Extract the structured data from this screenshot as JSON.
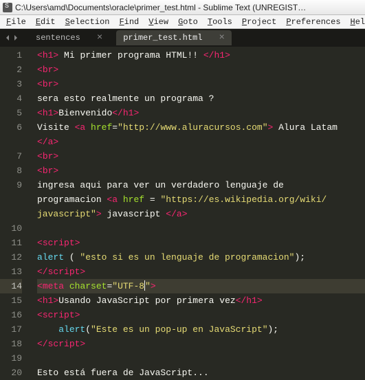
{
  "title": "C:\\Users\\amd\\Documents\\oracle\\primer_test.html - Sublime Text (UNREGIST…",
  "menu": [
    "File",
    "Edit",
    "Selection",
    "Find",
    "View",
    "Goto",
    "Tools",
    "Project",
    "Preferences",
    "Help"
  ],
  "tabs": [
    {
      "label": "sentences",
      "active": false
    },
    {
      "label": "primer_test.html",
      "active": true
    }
  ],
  "highlighted_line": 14,
  "lines": [
    {
      "n": 1,
      "seg": [
        [
          "t-tag",
          "<"
        ],
        [
          "t-tag",
          "h1"
        ],
        [
          "t-tag",
          ">"
        ],
        [
          "t-txt",
          " Mi primer programa HTML!! "
        ],
        [
          "t-tag",
          "</"
        ],
        [
          "t-tag",
          "h1"
        ],
        [
          "t-tag",
          ">"
        ]
      ]
    },
    {
      "n": 2,
      "seg": [
        [
          "t-tag",
          "<"
        ],
        [
          "t-tag",
          "br"
        ],
        [
          "t-tag",
          ">"
        ]
      ]
    },
    {
      "n": 3,
      "seg": [
        [
          "t-tag",
          "<"
        ],
        [
          "t-tag",
          "br"
        ],
        [
          "t-tag",
          ">"
        ]
      ]
    },
    {
      "n": 4,
      "seg": [
        [
          "t-txt",
          "sera esto realmente un programa ?"
        ]
      ]
    },
    {
      "n": 5,
      "seg": [
        [
          "t-tag",
          "<"
        ],
        [
          "t-tag",
          "h1"
        ],
        [
          "t-tag",
          ">"
        ],
        [
          "t-txt",
          "Bienvenido"
        ],
        [
          "t-tag",
          "</"
        ],
        [
          "t-tag",
          "h1"
        ],
        [
          "t-tag",
          ">"
        ]
      ]
    },
    {
      "n": 6,
      "seg": [
        [
          "t-txt",
          "Visite "
        ],
        [
          "t-tag",
          "<"
        ],
        [
          "t-tag",
          "a"
        ],
        [
          "t-txt",
          " "
        ],
        [
          "t-attr",
          "href"
        ],
        [
          "t-txt",
          "="
        ],
        [
          "t-str",
          "\"http://www.aluracursos.com\""
        ],
        [
          "t-tag",
          ">"
        ],
        [
          "t-txt",
          " Alura Latam"
        ]
      ]
    },
    {
      "n": "",
      "seg": [
        [
          "t-tag",
          "</"
        ],
        [
          "t-tag",
          "a"
        ],
        [
          "t-tag",
          ">"
        ]
      ]
    },
    {
      "n": 7,
      "seg": [
        [
          "t-tag",
          "<"
        ],
        [
          "t-tag",
          "br"
        ],
        [
          "t-tag",
          ">"
        ]
      ]
    },
    {
      "n": 8,
      "seg": [
        [
          "t-tag",
          "<"
        ],
        [
          "t-tag",
          "br"
        ],
        [
          "t-tag",
          ">"
        ]
      ]
    },
    {
      "n": 9,
      "seg": [
        [
          "t-txt",
          "ingresa aqui para ver un verdadero lenguaje de "
        ]
      ]
    },
    {
      "n": "",
      "seg": [
        [
          "t-txt",
          "programacion "
        ],
        [
          "t-tag",
          "<"
        ],
        [
          "t-tag",
          "a"
        ],
        [
          "t-txt",
          " "
        ],
        [
          "t-attr",
          "href"
        ],
        [
          "t-txt",
          " = "
        ],
        [
          "t-str",
          "\"https://es.wikipedia.org/wiki/"
        ]
      ]
    },
    {
      "n": "",
      "seg": [
        [
          "t-str",
          "javascript\""
        ],
        [
          "t-tag",
          ">"
        ],
        [
          "t-txt",
          " javascript "
        ],
        [
          "t-tag",
          "</"
        ],
        [
          "t-tag",
          "a"
        ],
        [
          "t-tag",
          ">"
        ]
      ]
    },
    {
      "n": 10,
      "seg": []
    },
    {
      "n": 11,
      "seg": [
        [
          "t-tag",
          "<"
        ],
        [
          "t-tag",
          "script"
        ],
        [
          "t-tag",
          ">"
        ]
      ]
    },
    {
      "n": 12,
      "seg": [
        [
          "t-fn",
          "alert"
        ],
        [
          "t-txt",
          " ( "
        ],
        [
          "t-str",
          "\"esto si es un lenguaje de programacion\""
        ],
        [
          "t-txt",
          ");"
        ]
      ]
    },
    {
      "n": 13,
      "seg": [
        [
          "t-tag",
          "</"
        ],
        [
          "t-tag",
          "script"
        ],
        [
          "t-tag",
          ">"
        ]
      ]
    },
    {
      "n": 14,
      "seg": [
        [
          "t-tag",
          "<"
        ],
        [
          "t-tag",
          "meta"
        ],
        [
          "t-txt",
          " "
        ],
        [
          "t-attr",
          "charset"
        ],
        [
          "t-txt",
          "="
        ],
        [
          "t-str",
          "\"UTF-8"
        ],
        [
          "cursor",
          ""
        ],
        [
          "t-str",
          "\""
        ],
        [
          "t-tag",
          ">"
        ]
      ]
    },
    {
      "n": 15,
      "seg": [
        [
          "t-tag",
          "<"
        ],
        [
          "t-tag",
          "h1"
        ],
        [
          "t-tag",
          ">"
        ],
        [
          "t-txt",
          "Usando JavaScript por primera vez"
        ],
        [
          "t-tag",
          "</"
        ],
        [
          "t-tag",
          "h1"
        ],
        [
          "t-tag",
          ">"
        ]
      ]
    },
    {
      "n": 16,
      "seg": [
        [
          "t-tag",
          "<"
        ],
        [
          "t-tag",
          "script"
        ],
        [
          "t-tag",
          ">"
        ]
      ]
    },
    {
      "n": 17,
      "seg": [
        [
          "t-txt",
          "    "
        ],
        [
          "t-fn",
          "alert"
        ],
        [
          "t-txt",
          "("
        ],
        [
          "t-str",
          "\"Este es un pop-up en JavaScript\""
        ],
        [
          "t-txt",
          ");"
        ]
      ]
    },
    {
      "n": 18,
      "seg": [
        [
          "t-tag",
          "</"
        ],
        [
          "t-tag",
          "script"
        ],
        [
          "t-tag",
          ">"
        ]
      ]
    },
    {
      "n": 19,
      "seg": []
    },
    {
      "n": 20,
      "seg": [
        [
          "t-txt",
          "Esto está fuera de JavaScript..."
        ]
      ]
    }
  ]
}
